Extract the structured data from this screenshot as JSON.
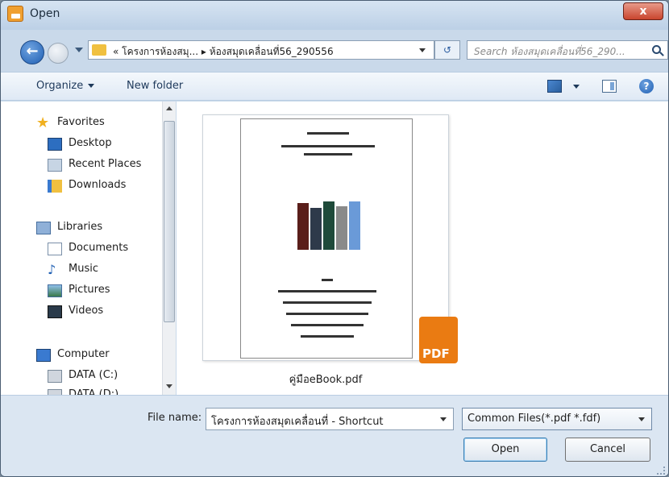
{
  "window": {
    "title": "Open",
    "close_label": "x"
  },
  "navigation": {
    "breadcrumb": "« โครงการห้องสมุ...  ▸  ห้องสมุดเคลื่อนที่56_290556",
    "refresh_label": "↺",
    "search_placeholder": "Search ห้องสมุดเคลื่อนที่56_290..."
  },
  "toolbar": {
    "organize": "Organize",
    "new_folder": "New folder",
    "help": "?"
  },
  "sidebar": {
    "favorites": "Favorites",
    "desktop": "Desktop",
    "recent_places": "Recent Places",
    "downloads": "Downloads",
    "libraries": "Libraries",
    "documents": "Documents",
    "music": "Music",
    "pictures": "Pictures",
    "videos": "Videos",
    "computer": "Computer",
    "drive_c": "DATA (C:)",
    "drive_d": "DATA (D:)"
  },
  "files": [
    {
      "name": "คู่มือeBook.pdf",
      "badge": "PDF"
    }
  ],
  "bottom": {
    "file_name_label": "File name:",
    "file_name_value": "โครงการห้องสมุดเคลื่อนที่ - Shortcut",
    "file_type": "Common Files(*.pdf *.fdf)",
    "open_button": "Open",
    "cancel_button": "Cancel"
  },
  "colors": {
    "titlebar": "#c9d9ea",
    "pdf_badge": "#ea7b12",
    "accent": "#1f5fb3"
  }
}
